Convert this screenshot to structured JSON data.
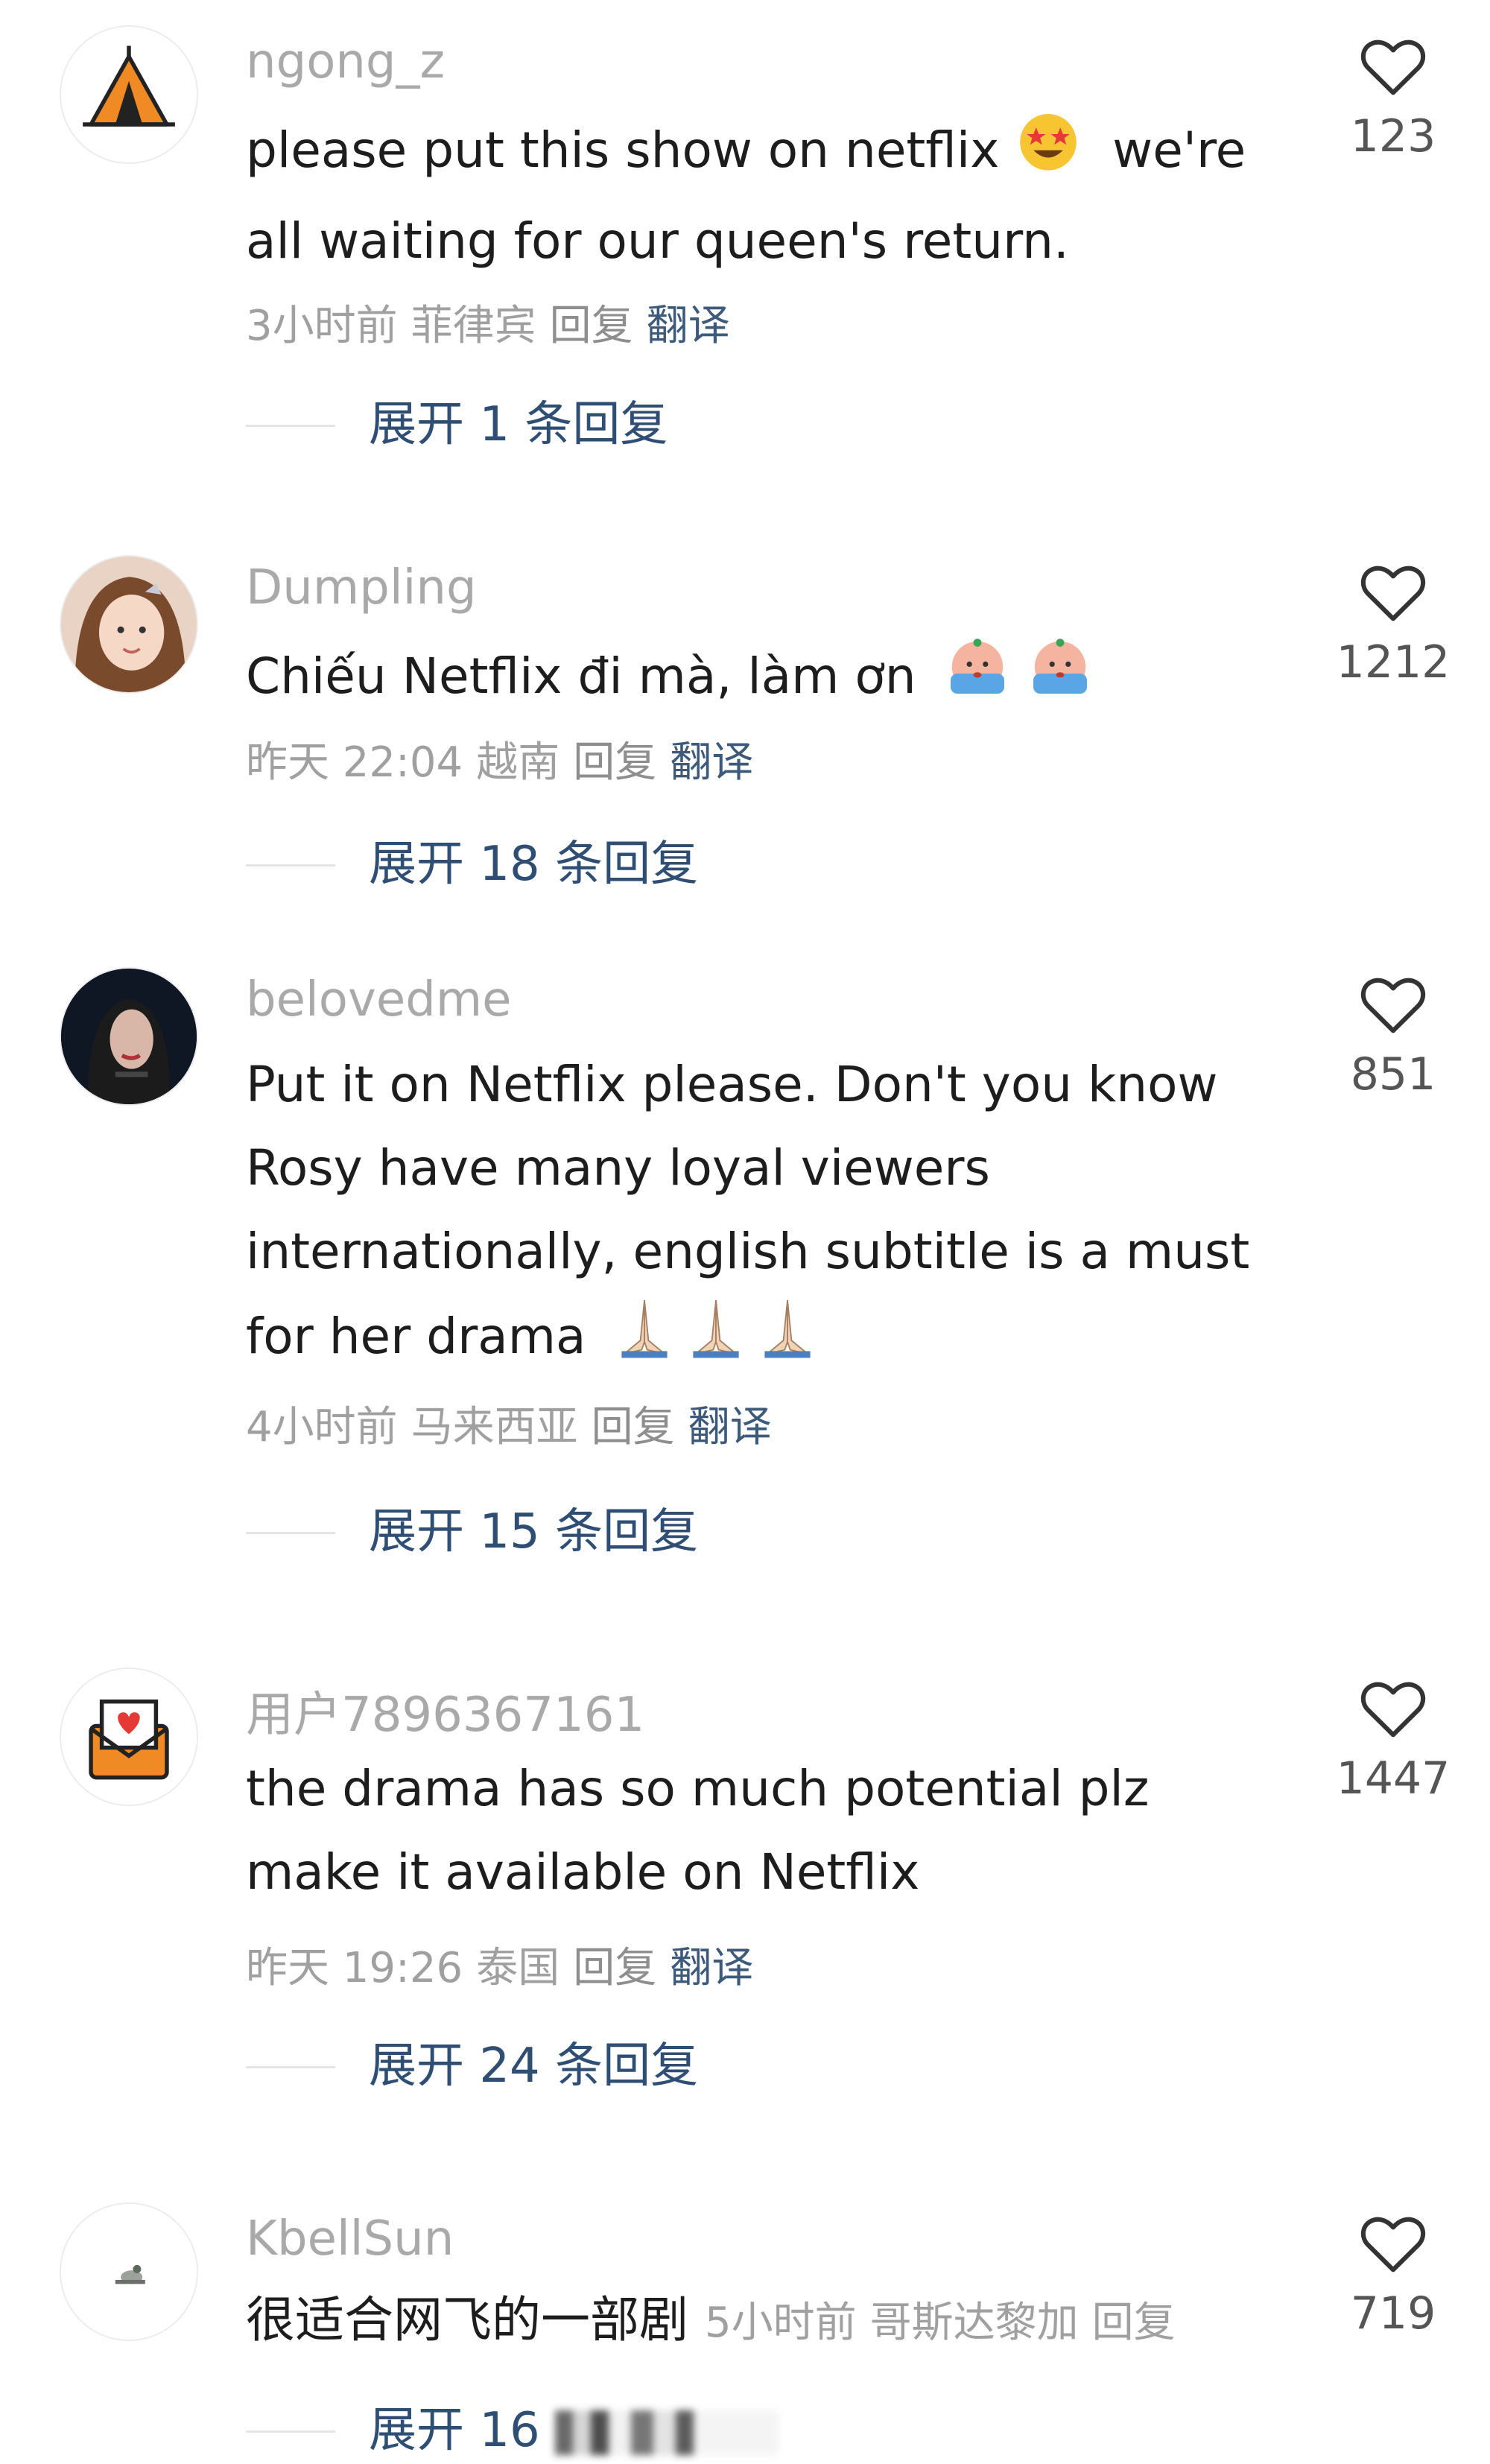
{
  "comments": [
    {
      "username": "ngong_z",
      "lines": [
        "please put this show on netflix",
        "we're",
        "all waiting for our queen's return."
      ],
      "meta": {
        "time": "3小时前",
        "location": "菲律宾",
        "reply": "回复",
        "translate": "翻译"
      },
      "expand": "展开 1 条回复",
      "likes": "123"
    },
    {
      "username": "Dumpling",
      "lines": [
        "Chiếu Netflix đi mà, làm ơn"
      ],
      "meta": {
        "time": "昨天 22:04",
        "location": "越南",
        "reply": "回复",
        "translate": "翻译"
      },
      "expand": "展开 18 条回复",
      "likes": "1212"
    },
    {
      "username": "belovedme",
      "lines": [
        "Put it on Netflix please. Don't you know",
        "Rosy have many loyal viewers",
        "internationally, english subtitle is a must",
        "for her drama"
      ],
      "meta": {
        "time": "4小时前",
        "location": "马来西亚",
        "reply": "回复",
        "translate": "翻译"
      },
      "expand": "展开 15 条回复",
      "likes": "851"
    },
    {
      "username": "用户7896367161",
      "lines": [
        "the drama has so much potential plz",
        "make it available on Netflix"
      ],
      "meta": {
        "time": "昨天 19:26",
        "location": "泰国",
        "reply": "回复",
        "translate": "翻译"
      },
      "expand": "展开 24 条回复",
      "likes": "1447"
    },
    {
      "username": "KbellSun",
      "lines": [
        "很适合网飞的一部剧"
      ],
      "meta": {
        "time": "5小时前",
        "location": "哥斯达黎加",
        "reply": "回复"
      },
      "expand": "展开 16",
      "likes": "719"
    }
  ],
  "icons": {
    "like": "heart-outline-icon",
    "avatar1": "tent-icon",
    "avatar4": "love-letter-icon"
  },
  "colors": {
    "username": "#a9a9a9",
    "body": "#1d1d1d",
    "meta": "#a0a0a0",
    "link": "#2e4e74",
    "tent": "#f08a24"
  }
}
